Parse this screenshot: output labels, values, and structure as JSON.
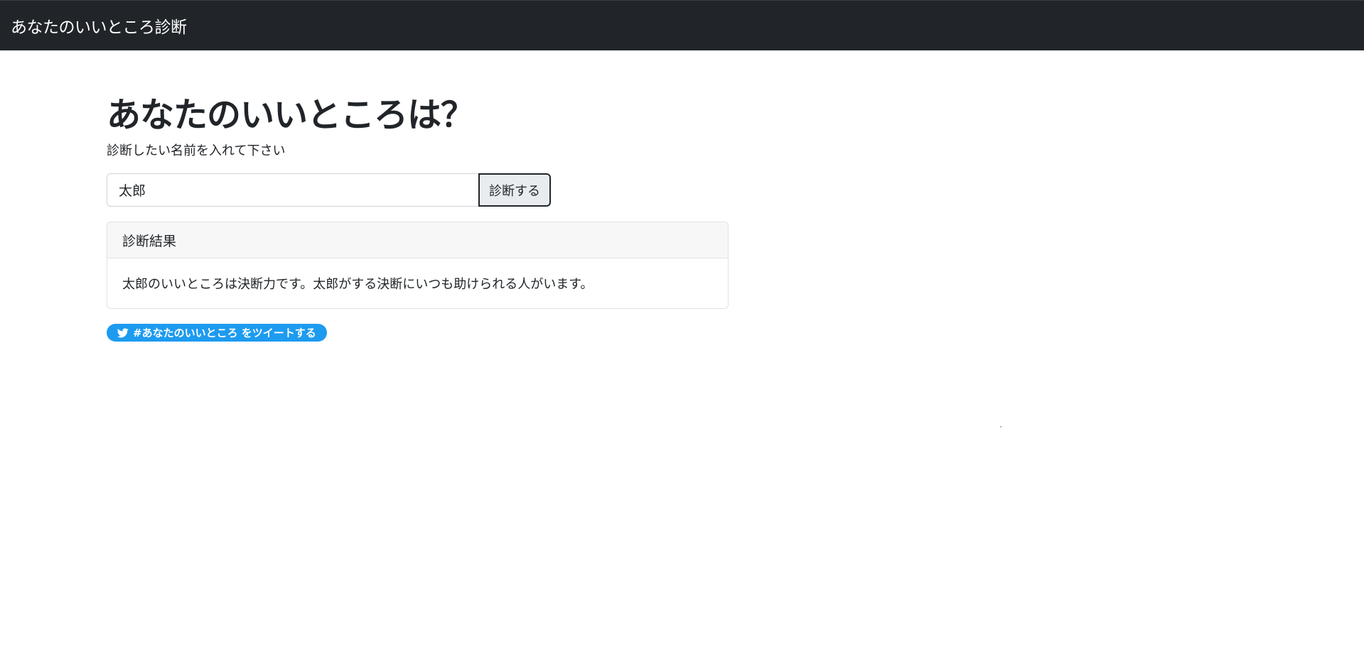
{
  "navbar": {
    "brand": "あなたのいいところ診断"
  },
  "main": {
    "title": "あなたのいいところは？",
    "lead": "診断したい名前を入れて下さい",
    "input": {
      "value": "太郎",
      "placeholder": ""
    },
    "submit_label": "診断する",
    "result": {
      "header": "診断結果",
      "body": "太郎のいいところは決断力です。太郎がする決断にいつも助けられる人がいます。"
    },
    "tweet": {
      "label": "#あなたのいいところ をツイートする",
      "icon": "twitter-bird-icon"
    }
  },
  "colors": {
    "navbar_bg": "#212529",
    "tweet_bg": "#1d9bf0",
    "card_header_bg": "#f7f7f7"
  }
}
